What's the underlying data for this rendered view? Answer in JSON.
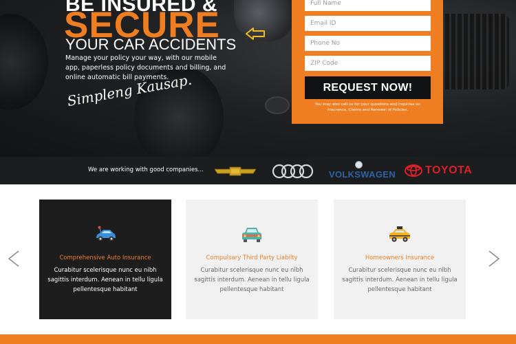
{
  "hero": {
    "title_line1": "BE INSURED &",
    "title_line2": "SECURE",
    "title_line3": "YOUR CAR ACCIDENTS",
    "body": "Manage your policy your way, with our mobile app, paperless policy documents and billing, and online automatic bill payments.",
    "signature": "Simpleng Kausap."
  },
  "form": {
    "full_name_placeholder": "Full Name",
    "email_placeholder": "Email ID",
    "phone_placeholder": "Phone No",
    "zip_placeholder": "ZIP Code",
    "submit_label": "REQUEST NOW!",
    "note": "You may also call us for your questions and inquiries on Insurance, Claims and Renewal of Policies."
  },
  "partners": {
    "text": "We are working with good companies...",
    "logos": [
      "chevrolet-logo",
      "audi-logo",
      "volkswagen-logo",
      "toyota-logo"
    ],
    "volkswagen_text": "VOLKSWAGEN",
    "toyota_text": "TOYOTA"
  },
  "services": {
    "cards": [
      {
        "icon": "blue-car-icon",
        "title": "Comprehensive Auto Insurance",
        "text": "Curabitur scelerisque nunc eu nibh sagittis interdum. Aenean in tellu ligula pellentesque habitant"
      },
      {
        "icon": "green-car-icon",
        "title": "Compulsary Third Party Liabilty",
        "text": "Curabitur scelerisque nunc eu nibh sagittis interdum. Aenean in tellu ligula pellentesque habitant"
      },
      {
        "icon": "taxi-icon",
        "title": "Homeowners Insurance",
        "text": "Curabitur scelerisque nunc eu nibh sagittis interdum. Aenean in tellu ligula pellentesque habitant"
      }
    ]
  },
  "colors": {
    "accent": "#ef7d22",
    "dark": "#1d1d1e",
    "card_light": "#f1f1f1"
  }
}
